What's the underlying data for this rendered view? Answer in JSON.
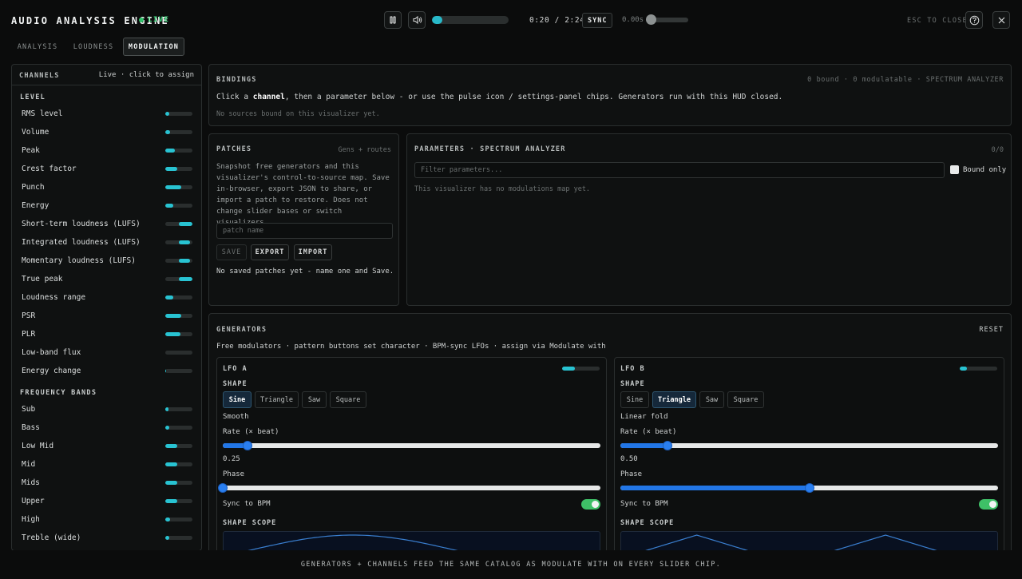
{
  "app": {
    "title": "AUDIO ANALYSIS ENGINE",
    "live_label": "LIVE",
    "time": "0:20 / 2:24",
    "sync_label": "SYNC",
    "offset": "0.00s",
    "progress": 0.14,
    "esc_label": "ESC TO CLOSE",
    "icons": [
      "pause-icon",
      "volume-icon",
      "help-icon",
      "close-icon"
    ]
  },
  "tabs": [
    {
      "label": "ANALYSIS",
      "active": false
    },
    {
      "label": "LOUDNESS",
      "active": false
    },
    {
      "label": "MODULATION",
      "active": true
    }
  ],
  "channels": {
    "title": "CHANNELS",
    "hint": "Live · click to assign",
    "level": {
      "title": "LEVEL",
      "items": [
        {
          "label": "RMS level",
          "value": 0.15
        },
        {
          "label": "Volume",
          "value": 0.18
        },
        {
          "label": "Peak",
          "value": 0.35
        },
        {
          "label": "Crest factor",
          "value": 0.45
        },
        {
          "label": "Punch",
          "value": 0.58
        },
        {
          "label": "Energy",
          "value": 0.28
        },
        {
          "label": "Short-term loudness (LUFS)",
          "value": 1.0,
          "start": 0.5
        },
        {
          "label": "Integrated loudness (LUFS)",
          "value": 0.9,
          "start": 0.5
        },
        {
          "label": "Momentary loudness (LUFS)",
          "value": 0.9,
          "start": 0.5
        },
        {
          "label": "True peak",
          "value": 1.0,
          "start": 0.5
        },
        {
          "label": "Loudness range",
          "value": 0.3
        },
        {
          "label": "PSR",
          "value": 0.58
        },
        {
          "label": "PLR",
          "value": 0.55
        },
        {
          "label": "Low-band flux",
          "value": 0.0
        },
        {
          "label": "Energy change",
          "value": 0.03
        }
      ]
    },
    "bands": {
      "title": "FREQUENCY BANDS",
      "items": [
        {
          "label": "Sub",
          "value": 0.12
        },
        {
          "label": "Bass",
          "value": 0.16
        },
        {
          "label": "Low Mid",
          "value": 0.45
        },
        {
          "label": "Mid",
          "value": 0.45
        },
        {
          "label": "Mids",
          "value": 0.45
        },
        {
          "label": "Upper",
          "value": 0.45
        },
        {
          "label": "High",
          "value": 0.18
        },
        {
          "label": "Treble (wide)",
          "value": 0.16
        }
      ]
    }
  },
  "bindings": {
    "title": "BINDINGS",
    "summary": "0 bound · 0 modulatable · SPECTRUM ANALYZER",
    "text_pre": "Click a ",
    "text_bold": "channel",
    "text_post": ", then a parameter below - or use the pulse icon / settings-panel chips. Generators run with this HUD closed.",
    "empty": "No sources bound on this visualizer yet."
  },
  "patches": {
    "title": "PATCHES",
    "subtitle": "Gens + routes",
    "description": "Snapshot free generators and this visualizer's control-to-source map. Save in-browser, export JSON to share, or import a patch to restore. Does not change slider bases or switch visualizers.",
    "name_placeholder": "patch name",
    "save_label": "SAVE",
    "export_label": "EXPORT",
    "import_label": "IMPORT",
    "empty": "No saved patches yet - name one and Save."
  },
  "parameters": {
    "title": "PARAMETERS · SPECTRUM ANALYZER",
    "count": "0/0",
    "filter_placeholder": "Filter parameters...",
    "bound_only_label": "Bound only",
    "empty": "This visualizer has no modulations map yet."
  },
  "generators": {
    "title": "GENERATORS",
    "reset_label": "RESET",
    "description": "Free modulators · pattern buttons set character · BPM-sync LFOs · assign via Modulate with",
    "lfos": [
      {
        "name": "LFO A",
        "level": 0.35,
        "shape_title": "SHAPE",
        "shapes": [
          "Sine",
          "Triangle",
          "Saw",
          "Square"
        ],
        "selected": 0,
        "character": "Smooth",
        "rate_label": "Rate (× beat)",
        "rate_value": "0.25",
        "rate_pos": 0.065,
        "phase_label": "Phase",
        "phase_pos": 0.0,
        "sync_label": "Sync to BPM",
        "sync_on": true,
        "scope_label": "SHAPE SCOPE",
        "wave": "sine"
      },
      {
        "name": "LFO B",
        "level": 0.2,
        "shape_title": "SHAPE",
        "shapes": [
          "Sine",
          "Triangle",
          "Saw",
          "Square"
        ],
        "selected": 1,
        "character": "Linear fold",
        "rate_label": "Rate (× beat)",
        "rate_value": "0.50",
        "rate_pos": 0.125,
        "phase_label": "Phase",
        "phase_pos": 0.5,
        "sync_label": "Sync to BPM",
        "sync_on": true,
        "scope_label": "SHAPE SCOPE",
        "wave": "triangle"
      }
    ]
  },
  "footer": "GENERATORS + CHANNELS FEED THE SAME CATALOG AS MODULATE WITH ON EVERY SLIDER CHIP.",
  "colors": {
    "accent": "#28c3d2",
    "live": "#30c46a",
    "slider": "#2276e6",
    "toggle": "#3ec067"
  }
}
